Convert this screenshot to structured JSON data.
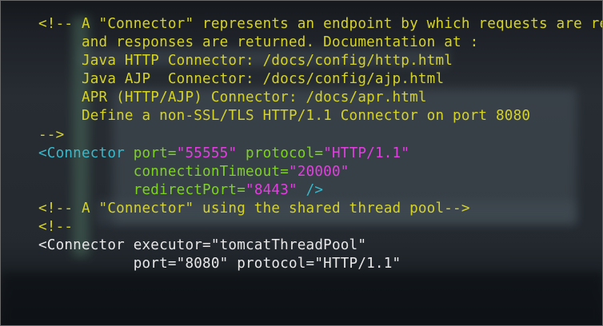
{
  "editor": {
    "lines": [
      {
        "comment": "<!-- A \"Connector\" represents an endpoint by which requests are received"
      },
      {
        "comment": "     and responses are returned. Documentation at :"
      },
      {
        "comment": "     Java HTTP Connector: /docs/config/http.html"
      },
      {
        "comment": "     Java AJP  Connector: /docs/config/ajp.html"
      },
      {
        "comment": "     APR (HTTP/AJP) Connector: /docs/apr.html"
      },
      {
        "comment": "     Define a non-SSL/TLS HTTP/1.1 Connector on port 8080"
      },
      {
        "comment": "-->"
      },
      {
        "tag": "<Connector",
        "attr1": " port",
        "eq1": "=",
        "val1": "\"55555\"",
        "attr2": " protocol",
        "eq2": "=",
        "val2": "\"HTTP/1.1\""
      },
      {
        "indent": "           ",
        "attr": "connectionTimeout",
        "eq": "=",
        "val": "\"20000\""
      },
      {
        "indent": "           ",
        "attr": "redirectPort",
        "eq": "=",
        "val": "\"8443\"",
        "close": " />"
      },
      {
        "comment": "<!-- A \"Connector\" using the shared thread pool-->"
      },
      {
        "comment": "<!--"
      },
      {
        "plain": "<Connector executor=\"tomcatThreadPool\""
      },
      {
        "plain": "           port=\"8080\" protocol=\"HTTP/1.1\""
      }
    ]
  },
  "colors": {
    "comment": "#d6d327",
    "tag": "#3bb8c9",
    "attribute": "#7ed321",
    "value": "#e23fe0",
    "plain": "#e8e8e8",
    "background": "#2e3238"
  }
}
